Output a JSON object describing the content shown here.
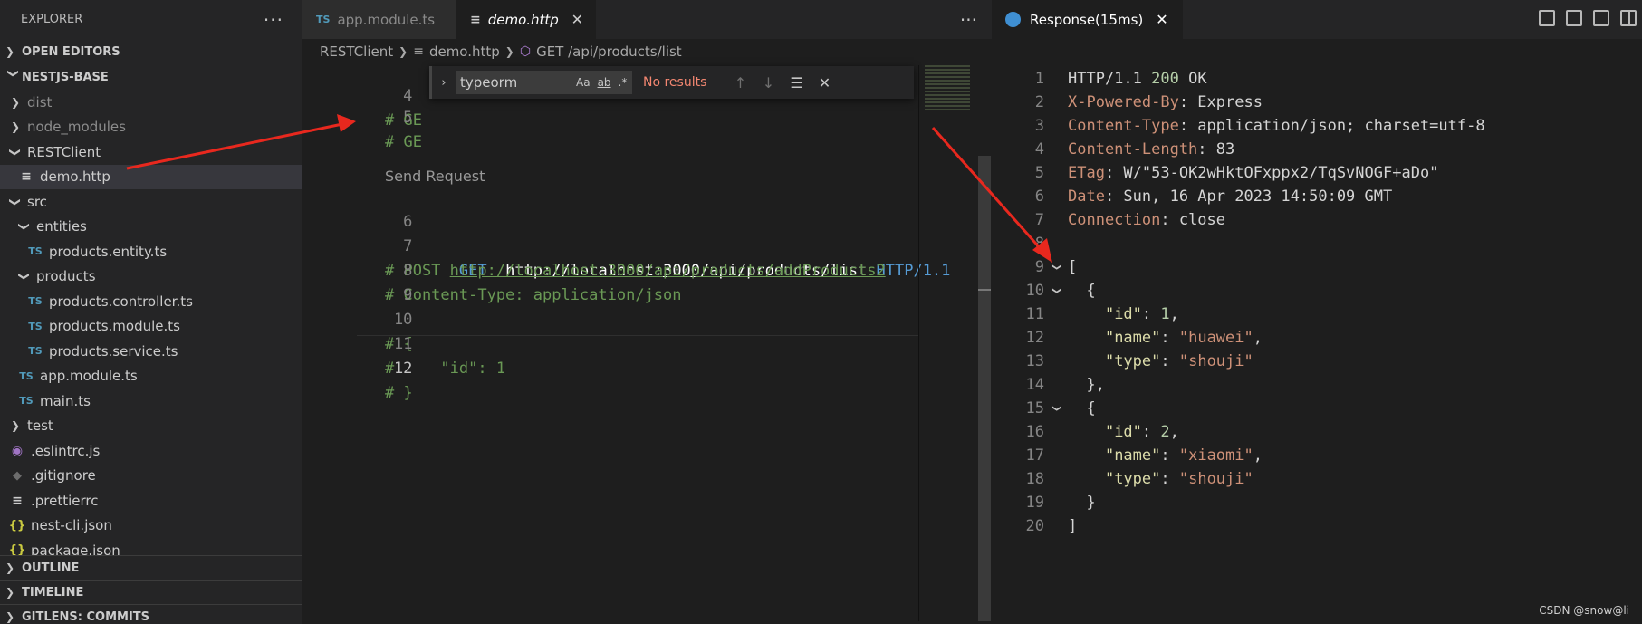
{
  "sidebar": {
    "title": "EXPLORER",
    "more": "···",
    "open_editors": "OPEN EDITORS",
    "project": "NESTJS-BASE",
    "tree": [
      {
        "label": "dist",
        "type": "folder",
        "dim": true
      },
      {
        "label": "node_modules",
        "type": "folder",
        "dim": true
      },
      {
        "label": "RESTClient",
        "type": "folder-open"
      },
      {
        "label": "demo.http",
        "type": "file-doc",
        "active": true
      },
      {
        "label": "src",
        "type": "folder-open"
      },
      {
        "label": "entities",
        "type": "folder-open"
      },
      {
        "label": "products.entity.ts",
        "type": "file-ts"
      },
      {
        "label": "products",
        "type": "folder-open"
      },
      {
        "label": "products.controller.ts",
        "type": "file-ts"
      },
      {
        "label": "products.module.ts",
        "type": "file-ts"
      },
      {
        "label": "products.service.ts",
        "type": "file-ts"
      },
      {
        "label": "app.module.ts",
        "type": "file-ts"
      },
      {
        "label": "main.ts",
        "type": "file-ts"
      },
      {
        "label": "test",
        "type": "folder"
      },
      {
        "label": ".eslintrc.js",
        "type": "file-eslint"
      },
      {
        "label": ".gitignore",
        "type": "file-git"
      },
      {
        "label": ".prettierrc",
        "type": "file-doc"
      },
      {
        "label": "nest-cli.json",
        "type": "file-json"
      },
      {
        "label": "package.json",
        "type": "file-json"
      }
    ],
    "bottom_sections": [
      "OUTLINE",
      "TIMELINE",
      "GITLENS: COMMITS"
    ]
  },
  "editor": {
    "tabs": [
      {
        "label": "app.module.ts",
        "icon": "TS",
        "active": false
      },
      {
        "label": "demo.http",
        "icon": "≡",
        "active": true,
        "close": "✕"
      }
    ],
    "more": "···",
    "breadcrumb": [
      "RESTClient",
      "demo.http",
      "GET /api/products/list"
    ],
    "codelens": "Send Request",
    "lines": [
      {
        "n": "4",
        "text": "# GE"
      },
      {
        "n": "5",
        "text": "# GE"
      },
      {
        "n": "6",
        "method": "GET",
        "url": "http://localhost:3000/api/products/list",
        "version": "HTTP/1.1"
      },
      {
        "n": "7",
        "prefix": "# POST ",
        "url": "http://localhost:3000/api/products/addProducts2"
      },
      {
        "n": "8",
        "text": "# Content-Type: application/json"
      },
      {
        "n": "9",
        "text": ""
      },
      {
        "n": "10",
        "text": "# {"
      },
      {
        "n": "11",
        "text": "#     \"id\": 1"
      },
      {
        "n": "12",
        "text": "# }"
      }
    ],
    "current_line": "12",
    "find": {
      "toggle": "›",
      "value": "typeorm",
      "opt_case": "Aa",
      "opt_word": "ab",
      "opt_regex": ".*",
      "result": "No results",
      "prev": "↑",
      "next": "↓",
      "selection": "☰",
      "close": "✕"
    }
  },
  "response": {
    "tab_label": "Response(15ms)",
    "close": "✕",
    "lines": [
      {
        "n": "1",
        "parts": [
          [
            "r-plain",
            "HTTP/1.1 "
          ],
          [
            "r-num",
            "200"
          ],
          [
            "r-plain",
            " OK"
          ]
        ]
      },
      {
        "n": "2",
        "parts": [
          [
            "r-key",
            "X-Powered-By"
          ],
          [
            "r-plain",
            ": Express"
          ]
        ]
      },
      {
        "n": "3",
        "parts": [
          [
            "r-key",
            "Content-Type"
          ],
          [
            "r-plain",
            ": application/json; charset=utf-8"
          ]
        ]
      },
      {
        "n": "4",
        "parts": [
          [
            "r-key",
            "Content-Length"
          ],
          [
            "r-plain",
            ": 83"
          ]
        ]
      },
      {
        "n": "5",
        "parts": [
          [
            "r-key",
            "ETag"
          ],
          [
            "r-plain",
            ": W/\"53-OK2wHktOFxppx2/TqSvNOGF+aDo\""
          ]
        ]
      },
      {
        "n": "6",
        "parts": [
          [
            "r-key",
            "Date"
          ],
          [
            "r-plain",
            ": Sun, 16 Apr 2023 14:50:09 GMT"
          ]
        ]
      },
      {
        "n": "7",
        "parts": [
          [
            "r-key",
            "Connection"
          ],
          [
            "r-plain",
            ": close"
          ]
        ]
      },
      {
        "n": "8",
        "parts": []
      },
      {
        "n": "9",
        "fold": true,
        "parts": [
          [
            "r-plain",
            "["
          ]
        ]
      },
      {
        "n": "10",
        "fold": true,
        "parts": [
          [
            "r-plain",
            "  {"
          ]
        ]
      },
      {
        "n": "11",
        "parts": [
          [
            "r-plain",
            "    "
          ],
          [
            "j-key",
            "\"id\""
          ],
          [
            "r-plain",
            ": "
          ],
          [
            "j-num",
            "1"
          ],
          [
            "r-plain",
            ","
          ]
        ]
      },
      {
        "n": "12",
        "parts": [
          [
            "r-plain",
            "    "
          ],
          [
            "j-key",
            "\"name\""
          ],
          [
            "r-plain",
            ": "
          ],
          [
            "j-str",
            "\"huawei\""
          ],
          [
            "r-plain",
            ","
          ]
        ]
      },
      {
        "n": "13",
        "parts": [
          [
            "r-plain",
            "    "
          ],
          [
            "j-key",
            "\"type\""
          ],
          [
            "r-plain",
            ": "
          ],
          [
            "j-str",
            "\"shouji\""
          ]
        ]
      },
      {
        "n": "14",
        "parts": [
          [
            "r-plain",
            "  },"
          ]
        ]
      },
      {
        "n": "15",
        "fold": true,
        "parts": [
          [
            "r-plain",
            "  {"
          ]
        ]
      },
      {
        "n": "16",
        "parts": [
          [
            "r-plain",
            "    "
          ],
          [
            "j-key",
            "\"id\""
          ],
          [
            "r-plain",
            ": "
          ],
          [
            "j-num",
            "2"
          ],
          [
            "r-plain",
            ","
          ]
        ]
      },
      {
        "n": "17",
        "parts": [
          [
            "r-plain",
            "    "
          ],
          [
            "j-key",
            "\"name\""
          ],
          [
            "r-plain",
            ": "
          ],
          [
            "j-str",
            "\"xiaomi\""
          ],
          [
            "r-plain",
            ","
          ]
        ]
      },
      {
        "n": "18",
        "parts": [
          [
            "r-plain",
            "    "
          ],
          [
            "j-key",
            "\"type\""
          ],
          [
            "r-plain",
            ": "
          ],
          [
            "j-str",
            "\"shouji\""
          ]
        ]
      },
      {
        "n": "19",
        "parts": [
          [
            "r-plain",
            "  }"
          ]
        ]
      },
      {
        "n": "20",
        "parts": [
          [
            "r-plain",
            "]"
          ]
        ]
      }
    ],
    "watermark": "CSDN @snow@li"
  },
  "colors": {
    "accent": "#569cd6",
    "arrow": "#e8281e",
    "find_no_results": "#f48771"
  }
}
